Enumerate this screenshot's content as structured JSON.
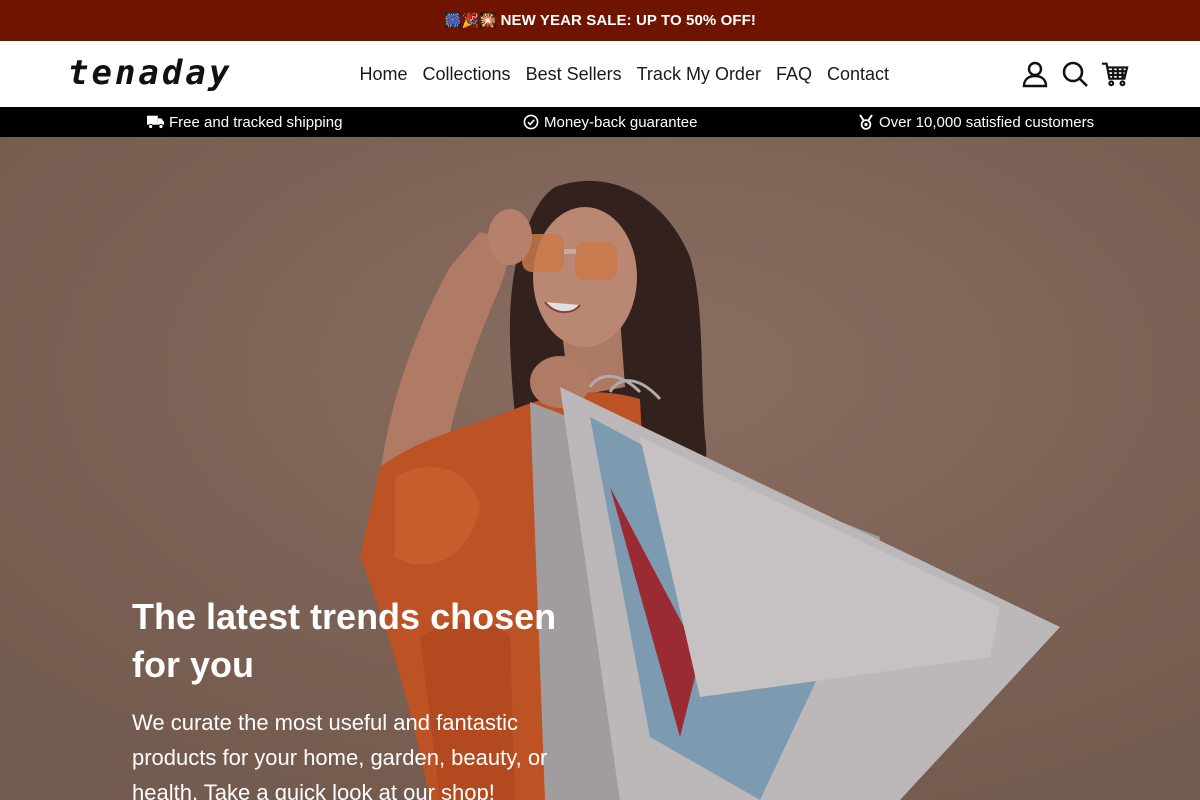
{
  "announcement": {
    "emoji": "🎆🎉🎇",
    "text": "NEW YEAR SALE: UP TO 50% OFF!"
  },
  "header": {
    "logo": "tenaday",
    "nav": [
      "Home",
      "Collections",
      "Best Sellers",
      "Track My Order",
      "FAQ",
      "Contact"
    ],
    "icons": [
      "account-icon",
      "search-icon",
      "cart-icon"
    ]
  },
  "trust_bar": {
    "items": [
      {
        "icon": "truck-icon",
        "text": "Free and tracked shipping"
      },
      {
        "icon": "check-circle-icon",
        "text": "Money-back guarantee"
      },
      {
        "icon": "medal-icon",
        "text": "Over 10,000 satisfied customers"
      }
    ]
  },
  "hero": {
    "title": "The latest trends chosen for you",
    "text": "We curate the most useful and fantastic products for your home, garden, beauty, or health. Take a quick look at our shop!"
  },
  "colors": {
    "announcement_bg": "#6e1400",
    "trust_bar_bg": "#000000",
    "hero_bg": "#8e7062"
  }
}
